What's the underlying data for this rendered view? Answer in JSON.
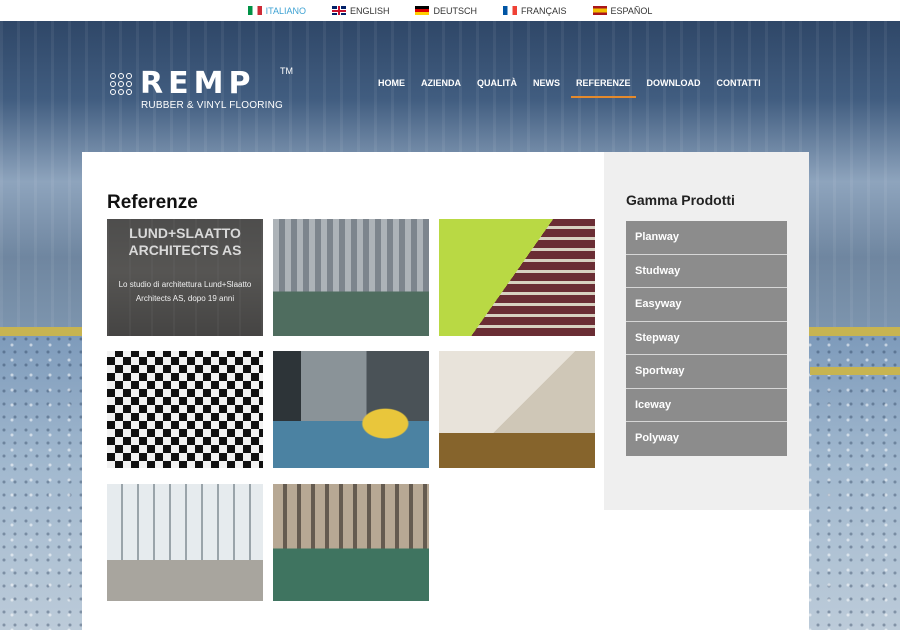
{
  "languages": [
    {
      "label": "ITALIANO",
      "flag": "italy-flag-icon",
      "active": true
    },
    {
      "label": "ENGLISH",
      "flag": "uk-flag-icon",
      "active": false
    },
    {
      "label": "DEUTSCH",
      "flag": "germany-flag-icon",
      "active": false
    },
    {
      "label": "FRANÇAIS",
      "flag": "france-flag-icon",
      "active": false
    },
    {
      "label": "ESPAÑOL",
      "flag": "spain-flag-icon",
      "active": false
    }
  ],
  "brand": {
    "name": "REMP",
    "trademark": "TM",
    "tagline": "RUBBER & VINYL FLOORING"
  },
  "nav": {
    "items": [
      "HOME",
      "AZIENDA",
      "QUALITÀ",
      "NEWS",
      "REFERENZE",
      "DOWNLOAD",
      "CONTATTI"
    ],
    "active": "REFERENZE",
    "accent_color": "#e48a2c"
  },
  "page": {
    "title": "Referenze"
  },
  "gallery": {
    "featured": {
      "title": "LUND+SLAATTO ARCHITECTS AS",
      "text": "Lo studio di architettura Lund+Slaatto Architects AS, dopo 19 anni"
    },
    "tiles": [
      "office-photo",
      "gym-corridor-photo",
      "shop-aisle-photo",
      "lounge-checkered-floor-photo",
      "metro-station-photo",
      "lobby-hall-photo",
      "cafeteria-photo",
      "fitness-center-photo"
    ]
  },
  "sidebar": {
    "title": "Gamma Prodotti",
    "items": [
      "Planway",
      "Studway",
      "Easyway",
      "Stepway",
      "Sportway",
      "Iceway",
      "Polyway"
    ]
  },
  "colors": {
    "active_language": "#3ea2d3",
    "sidebar_item_bg": "#8c8c8c",
    "floor_stripe": "#c7b451"
  }
}
